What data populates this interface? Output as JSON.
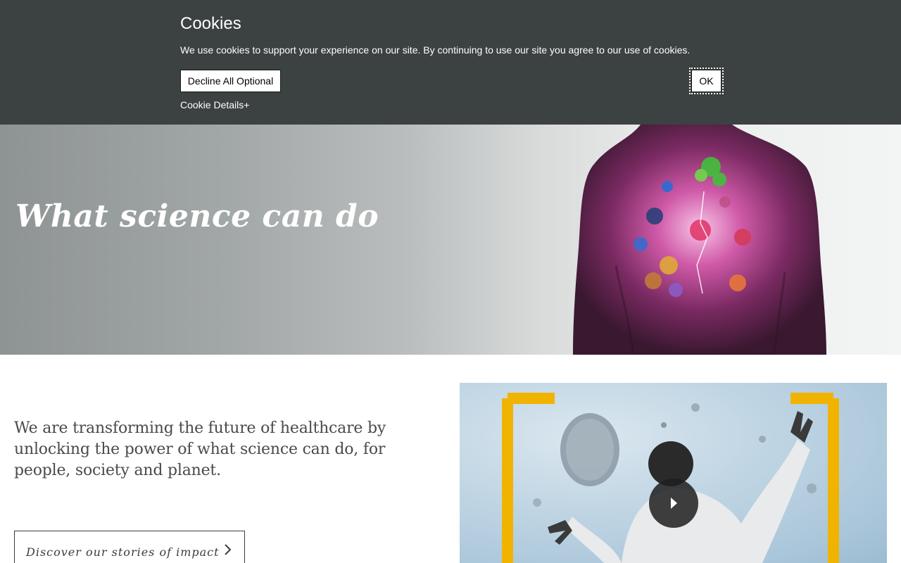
{
  "cookie_banner": {
    "title": "Cookies",
    "message": "We use cookies to support your experience on our site. By continuing to use our site you agree to our use of cookies.",
    "decline_label": "Decline All Optional",
    "ok_label": "OK",
    "details_label": "Cookie Details+"
  },
  "hero": {
    "title": "What science can do",
    "image_icon": "human-back-molecules-illustration"
  },
  "intro": {
    "text": "We are transforming the future of healthcare by unlocking the power of what science can do, for people, society and planet."
  },
  "cta": {
    "label": "Discover our stories of impact",
    "icon": "chevron-right-icon"
  },
  "video": {
    "image_icon": "scientist-microscope-video-thumbnail",
    "play_icon": "play-icon"
  },
  "colors": {
    "banner_bg": "#3c4142",
    "frame_accent": "#f0b400",
    "text_dark": "#4a4a4a"
  }
}
